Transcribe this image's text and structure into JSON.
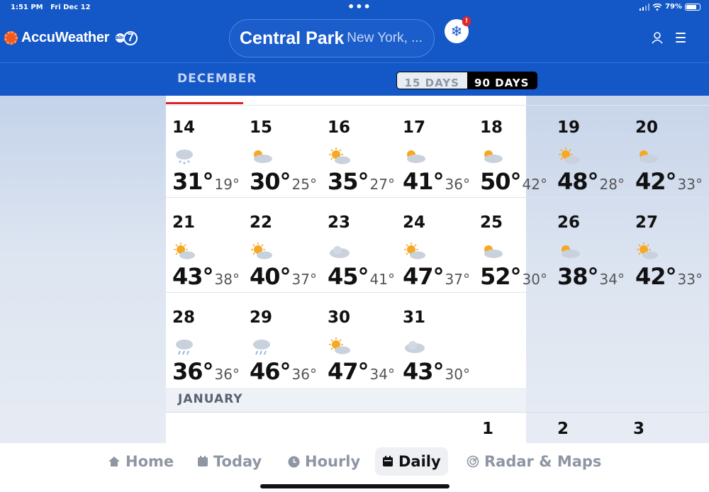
{
  "status_bar": {
    "time": "1:51 PM",
    "date": "Fri Dec 12",
    "battery": "79%",
    "battery_level": 0.79
  },
  "header": {
    "brand": "AccuWeather",
    "partner": {
      "small": "abc",
      "number": "7"
    },
    "location_city": "Central Park",
    "location_region": "New York, ...",
    "alert_count": "!",
    "icons": {
      "alert": "snowflake-icon",
      "user": "user-icon",
      "menu": "menu-icon"
    }
  },
  "month_bar": {
    "month": "DECEMBER",
    "toggle": [
      {
        "label": "15 DAYS",
        "active": false
      },
      {
        "label": "90 DAYS",
        "active": true
      }
    ]
  },
  "calendar": {
    "rows": [
      [
        {
          "day": "14",
          "hi": "31°",
          "lo": "19°",
          "icon": "snow"
        },
        {
          "day": "15",
          "hi": "30°",
          "lo": "25°",
          "icon": "mostly-cloudy-sun"
        },
        {
          "day": "16",
          "hi": "35°",
          "lo": "27°",
          "icon": "partly-sunny"
        },
        {
          "day": "17",
          "hi": "41°",
          "lo": "36°",
          "icon": "mostly-cloudy-sun"
        },
        {
          "day": "18",
          "hi": "50°",
          "lo": "42°",
          "icon": "mostly-cloudy-sun"
        },
        {
          "day": "19",
          "hi": "48°",
          "lo": "28°",
          "icon": "partly-sunny"
        },
        {
          "day": "20",
          "hi": "42°",
          "lo": "33°",
          "icon": "mostly-cloudy-sun"
        }
      ],
      [
        {
          "day": "21",
          "hi": "43°",
          "lo": "38°",
          "icon": "partly-sunny"
        },
        {
          "day": "22",
          "hi": "40°",
          "lo": "37°",
          "icon": "partly-sunny"
        },
        {
          "day": "23",
          "hi": "45°",
          "lo": "41°",
          "icon": "cloudy"
        },
        {
          "day": "24",
          "hi": "47°",
          "lo": "37°",
          "icon": "partly-sunny"
        },
        {
          "day": "25",
          "hi": "52°",
          "lo": "30°",
          "icon": "mostly-cloudy-sun"
        },
        {
          "day": "26",
          "hi": "38°",
          "lo": "34°",
          "icon": "mostly-cloudy-sun"
        },
        {
          "day": "27",
          "hi": "42°",
          "lo": "33°",
          "icon": "partly-sunny"
        }
      ],
      [
        {
          "day": "28",
          "hi": "36°",
          "lo": "36°",
          "icon": "rain"
        },
        {
          "day": "29",
          "hi": "46°",
          "lo": "36°",
          "icon": "rain"
        },
        {
          "day": "30",
          "hi": "47°",
          "lo": "34°",
          "icon": "partly-sunny"
        },
        {
          "day": "31",
          "hi": "43°",
          "lo": "30°",
          "icon": "cloudy"
        }
      ]
    ],
    "next_month": "JANUARY",
    "next_days": [
      "1",
      "2",
      "3"
    ]
  },
  "bottom_nav": [
    {
      "label": "Home",
      "icon": "home-icon",
      "active": false
    },
    {
      "label": "Today",
      "icon": "calendar-icon",
      "active": false
    },
    {
      "label": "Hourly",
      "icon": "clock-icon",
      "active": false
    },
    {
      "label": "Daily",
      "icon": "calendar-icon",
      "active": true
    },
    {
      "label": "Radar & Maps",
      "icon": "radar-icon",
      "active": false
    }
  ],
  "colors": {
    "brand_blue": "#1457c6",
    "today_accent": "#d9242b",
    "sun": "#f7a823",
    "cloud": "#c9d1dc"
  }
}
